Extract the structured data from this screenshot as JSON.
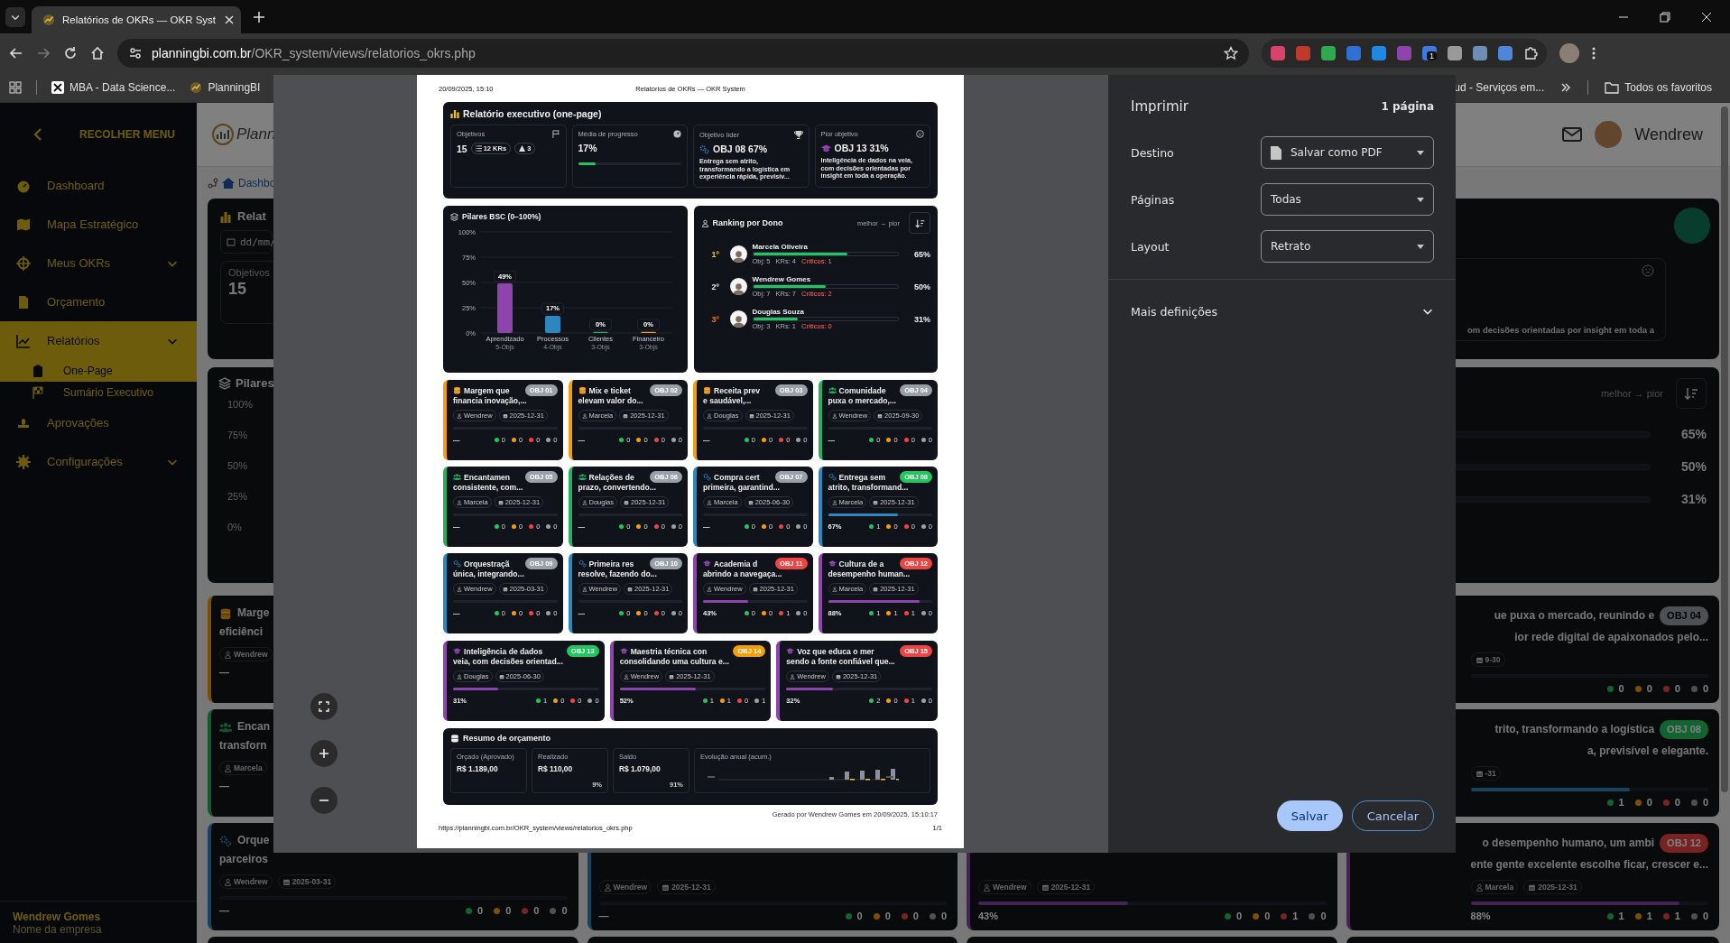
{
  "browser": {
    "tab_title": "Relatórios de OKRs — OKR Syst",
    "url_host": "planningbi.com.br",
    "url_path": "/OKR_system/views/relatorios_okrs.php",
    "extension_badge": "1",
    "bookmarks_left": [
      "MBA - Data Science...",
      "PlanningBI"
    ],
    "bookmarks_right": [
      "ud - Serviços em...",
      "Todos os favoritos"
    ]
  },
  "sidebar": {
    "collapse_label": "RECOLHER MENU",
    "items": [
      {
        "label": "Dashboard",
        "kind": "link",
        "selected": false
      },
      {
        "label": "Mapa Estratégico",
        "kind": "link",
        "selected": false
      },
      {
        "label": "Meus OKRs",
        "kind": "group",
        "selected": false
      },
      {
        "label": "Orçamento",
        "kind": "link",
        "selected": false
      },
      {
        "label": "Relatórios",
        "kind": "group",
        "selected": true,
        "children": [
          {
            "label": "One-Page",
            "selected": true
          },
          {
            "label": "Sumário Executivo",
            "selected": false
          }
        ]
      },
      {
        "label": "Aprovações",
        "kind": "link",
        "selected": false
      },
      {
        "label": "Configurações",
        "kind": "group",
        "selected": false
      }
    ],
    "user_name": "Wendrew Gomes",
    "company": "Nome da empresa"
  },
  "background": {
    "logo_text": "Plann",
    "breadcrumb": "Dashbo",
    "user": "Wendrew",
    "exec": {
      "title": "Relat",
      "date_placeholder": "dd/mm/",
      "kpi_label": "Objetivos",
      "kpi_value": "15",
      "worst_text": "om decisões orientadas por insight em toda a"
    },
    "pillars": {
      "title": "Pilares",
      "ticks": [
        "100%",
        "75%",
        "50%",
        "25%",
        "0%"
      ]
    },
    "ranking": {
      "hint": "melhor → pior",
      "values": [
        "65%",
        "50%",
        "31%"
      ]
    },
    "left_cards": [
      {
        "kind": "financeiro",
        "title_lines": [
          "Marge",
          "eficiênci"
        ],
        "owner": "Wendrew",
        "progress": "—"
      },
      {
        "kind": "clientes",
        "title_lines": [
          "Encan",
          "transforn"
        ],
        "owner": "Marcela",
        "progress": "—"
      },
      {
        "kind": "processos",
        "title_lines": [
          "Orque",
          "parceiros"
        ],
        "owner": "Wendrew",
        "date": "2025-03-31",
        "level": 0,
        "progress": "—",
        "counts": [
          "0",
          "0",
          "0",
          "0"
        ]
      }
    ],
    "bottom_cards": [
      {
        "kind": "processos",
        "owner": "Wendrew",
        "date": "2025-12-31",
        "level": 0,
        "progress": "—",
        "counts": [
          "0",
          "0",
          "0",
          "0"
        ]
      },
      {
        "kind": "aprendizado",
        "owner": "Wendrew",
        "date": "2025-12-31",
        "level": 0.43,
        "progress": "43%",
        "counts": [
          "0",
          "0",
          "1",
          "0"
        ]
      }
    ],
    "right_cards": [
      {
        "kind": "clientes",
        "title_lines": [
          "ue puxa o mercado, reunindo e",
          "ior rede digital de apaixonados pelo..."
        ],
        "badge": "OBJ 04",
        "color": "#4d5054",
        "date": "9-30",
        "level": 0,
        "counts": [
          "0",
          "0",
          "0",
          "0"
        ]
      },
      {
        "kind": "processos",
        "title_lines": [
          "trito, transformando a logística",
          "a, previsível e elegante."
        ],
        "badge": "OBJ 08",
        "color": "#11632f",
        "date": "-31",
        "level": 0.67,
        "counts": [
          "1",
          "0",
          "0",
          "0"
        ]
      },
      {
        "kind": "aprendizado",
        "title_lines": [
          "o desempenho humano, um ambi",
          "ente gente excelente escolhe ficar, crescer e..."
        ],
        "badge": "OBJ 12",
        "color": "#782222",
        "owner": "Marcela",
        "date": "2025-12-31",
        "level": 0.88,
        "progress": "88%",
        "counts": [
          "1",
          "1",
          "1",
          "0"
        ]
      }
    ]
  },
  "preview": {
    "print_date": "20/09/2025, 15:10",
    "print_title": "Relatórios de OKRs — OKR System",
    "exec": {
      "title": "Relatório executivo (one-page)",
      "kpis": [
        {
          "kind": "count",
          "label": "Objetivos",
          "value": "15",
          "chips": [
            "12 KRs",
            "3"
          ]
        },
        {
          "kind": "progress",
          "label": "Média de progresso",
          "value": "17%",
          "level": 0.17
        },
        {
          "kind": "best",
          "label": "Objetivo líder",
          "value": "OBJ 08 67%",
          "icon": {
            "kind": "processos"
          },
          "text": "Entrega sem atrito, transformando a logística em experiência rápida, previsív..."
        },
        {
          "kind": "worst",
          "label": "Pior objetivo",
          "value": "OBJ 13 31%",
          "icon": {
            "kind": "aprendizado"
          },
          "text": "Inteligência de dados na veia, com decisões orientadas por insight em toda a operação."
        }
      ]
    },
    "pillars": {
      "bars": [
        {
          "color": "#8e44ad",
          "objs": "5-Objs"
        },
        {
          "color": "#2e86c1",
          "objs": "4-Objs"
        },
        {
          "color": "#27ae60",
          "objs": "3-Objs"
        },
        {
          "color": "#f39c12",
          "objs": "3-Objs"
        }
      ],
      "chart_data": {
        "type": "bar",
        "title": "Pilares BSC (0–100%)",
        "categories": [
          "Aprendizado",
          "Processos",
          "Clientes",
          "Financeiro"
        ],
        "values": [
          49,
          17,
          0,
          0
        ],
        "ylim": [
          0,
          100
        ],
        "yticks": [
          {
            "value": 0,
            "label": "0%"
          },
          {
            "value": 25,
            "label": "25%"
          },
          {
            "value": 50,
            "label": "50%"
          },
          {
            "value": 75,
            "label": "75%"
          },
          {
            "value": 100,
            "label": "100%"
          }
        ],
        "grid": true,
        "data_labels": true,
        "value_labels": [
          "49%",
          "17%",
          "0%",
          "0%"
        ]
      }
    },
    "ranking": {
      "title": "Ranking por Dono",
      "hint": "melhor → pior",
      "owners": [
        {
          "rank": "1º",
          "color": "#f1c40f",
          "name": "Marcela Oliveira",
          "level": 0.65,
          "percent": "65%",
          "obj": "Obj: 5",
          "krs": "KRs: 4",
          "critical": "Críticos: 1"
        },
        {
          "rank": "2º",
          "color": "#e6e6e6",
          "name": "Wendrew Gomes",
          "level": 0.5,
          "percent": "50%",
          "obj": "Obj: 7",
          "krs": "KRs: 7",
          "critical": "Críticos: 2"
        },
        {
          "rank": "3º",
          "color": "#e67e22",
          "name": "Douglas Souza",
          "level": 0.31,
          "percent": "31%",
          "obj": "Obj: 3",
          "krs": "KRs: 1",
          "critical": "Críticos: 0"
        }
      ]
    },
    "objectives": [
      {
        "kind": "financeiro",
        "title_lines": [
          "Margem que",
          "financia inovação,..."
        ],
        "badge": "OBJ 01",
        "color": "#9aa0a8",
        "owner": "Wendrew",
        "date": "2025-12-31",
        "level": 0,
        "progress": "—",
        "counts": [
          "0",
          "0",
          "0",
          "0"
        ]
      },
      {
        "kind": "financeiro",
        "title_lines": [
          "Mix e ticket",
          "elevam valor do..."
        ],
        "badge": "OBJ 02",
        "color": "#9aa0a8",
        "owner": "Marcela",
        "date": "2025-12-31",
        "level": 0,
        "progress": "—",
        "counts": [
          "0",
          "0",
          "0",
          "0"
        ]
      },
      {
        "kind": "financeiro",
        "title_lines": [
          "Receita prev",
          "e saudável,..."
        ],
        "badge": "OBJ 03",
        "color": "#9aa0a8",
        "owner": "Douglas",
        "date": "2025-12-31",
        "level": 0,
        "progress": "—",
        "counts": [
          "0",
          "0",
          "0",
          "0"
        ]
      },
      {
        "kind": "clientes",
        "title_lines": [
          "Comunidade",
          "puxa o mercado,..."
        ],
        "badge": "OBJ 04",
        "color": "#9aa0a8",
        "owner": "Wendrew",
        "date": "2025-09-30",
        "level": 0,
        "progress": "—",
        "counts": [
          "0",
          "0",
          "0",
          "0"
        ]
      },
      {
        "kind": "clientes",
        "title_lines": [
          "Encantamen",
          "consistente, com..."
        ],
        "badge": "OBJ 05",
        "color": "#9aa0a8",
        "owner": "Marcela",
        "date": "2025-12-31",
        "level": 0,
        "progress": "—",
        "counts": [
          "0",
          "0",
          "0",
          "0"
        ]
      },
      {
        "kind": "clientes",
        "title_lines": [
          "Relações de",
          "prazo, convertendo..."
        ],
        "badge": "OBJ 06",
        "color": "#9aa0a8",
        "owner": "Douglas",
        "date": "2025-12-31",
        "level": 0,
        "progress": "—",
        "counts": [
          "0",
          "0",
          "0",
          "0"
        ]
      },
      {
        "kind": "processos",
        "title_lines": [
          "Compra cert",
          "primeira, garantind..."
        ],
        "badge": "OBJ 07",
        "color": "#9aa0a8",
        "owner": "Marcela",
        "date": "2025-06-30",
        "level": 0,
        "progress": "—",
        "counts": [
          "0",
          "0",
          "0",
          "0"
        ]
      },
      {
        "kind": "processos",
        "title_lines": [
          "Entrega sem",
          "atrito, transformand..."
        ],
        "badge": "OBJ 08",
        "color": "#22c55e",
        "owner": "Marcela",
        "date": "2025-12-31",
        "level": 0.67,
        "progress": "67%",
        "counts": [
          "1",
          "0",
          "0",
          "0"
        ]
      },
      {
        "kind": "processos",
        "title_lines": [
          "Orquestraçã",
          "única, integrando..."
        ],
        "badge": "OBJ 09",
        "color": "#9aa0a8",
        "owner": "Wendrew",
        "date": "2025-03-31",
        "level": 0,
        "progress": "—",
        "counts": [
          "0",
          "0",
          "0",
          "0"
        ]
      },
      {
        "kind": "processos",
        "title_lines": [
          "Primeira res",
          "resolve, fazendo do..."
        ],
        "badge": "OBJ 10",
        "color": "#9aa0a8",
        "owner": "Wendrew",
        "date": "2025-12-31",
        "level": 0,
        "progress": "—",
        "counts": [
          "0",
          "0",
          "0",
          "0"
        ]
      },
      {
        "kind": "aprendizado",
        "title_lines": [
          "Academia d",
          "abrindo a navegaça..."
        ],
        "badge": "OBJ 11",
        "color": "#ef4444",
        "owner": "Wendrew",
        "date": "2025-12-31",
        "level": 0.43,
        "progress": "43%",
        "counts": [
          "0",
          "0",
          "1",
          "0"
        ]
      },
      {
        "kind": "aprendizado",
        "title_lines": [
          "Cultura de a",
          "desempenho human..."
        ],
        "badge": "OBJ 12",
        "color": "#ef4444",
        "owner": "Marcela",
        "date": "2025-12-31",
        "level": 0.88,
        "progress": "88%",
        "counts": [
          "1",
          "1",
          "1",
          "0"
        ]
      },
      {
        "kind": "aprendizado",
        "title_lines": [
          "Inteligência de dados",
          "veia, com decisões orientad..."
        ],
        "badge": "OBJ 13",
        "color": "#22c55e",
        "owner": "Douglas",
        "date": "2025-06-30",
        "level": 0.31,
        "progress": "31%",
        "counts": [
          "1",
          "0",
          "0",
          "0"
        ]
      },
      {
        "kind": "aprendizado",
        "title_lines": [
          "Maestria técnica con",
          "consolidando uma cultura e..."
        ],
        "badge": "OBJ 14",
        "color": "#f59e0b",
        "owner": "Wendrew",
        "date": "2025-12-31",
        "level": 0.52,
        "progress": "52%",
        "counts": [
          "1",
          "1",
          "0",
          "1"
        ]
      },
      {
        "kind": "aprendizado",
        "title_lines": [
          "Voz que educa o mer",
          "sendo a fonte confiável que..."
        ],
        "badge": "OBJ 15",
        "color": "#ef4444",
        "owner": "Wendrew",
        "date": "2025-12-31",
        "level": 0.32,
        "progress": "32%",
        "counts": [
          "2",
          "0",
          "1",
          "0"
        ]
      }
    ],
    "budget": {
      "title": "Resumo de orçamento",
      "tiles": [
        {
          "label": "Orçado (Aprovado)",
          "value": "R$ 1.189,00"
        },
        {
          "label": "Realizado",
          "value": "R$ 110,00",
          "share": "9%"
        },
        {
          "label": "Saldo",
          "value": "R$ 1.079,00",
          "share": "91%"
        }
      ],
      "evolution_label": "Evolução anual (acum.)"
    },
    "generated": "Gerado por Wendrew Gomes em 20/09/2025, 15:10:17",
    "footer_url": "https://planningbi.com.br/OKR_system/views/relatorios_okrs.php",
    "footer_page": "1/1"
  },
  "print_dialog": {
    "title": "Imprimir",
    "page_count": "1 página",
    "fields": [
      {
        "kind": "destination",
        "label": "Destino",
        "value": "Salvar como PDF"
      },
      {
        "kind": "plain",
        "label": "Páginas",
        "value": "Todas"
      },
      {
        "kind": "plain",
        "label": "Layout",
        "value": "Retrato"
      }
    ],
    "more": "Mais definições",
    "buttons": [
      {
        "kind": "primary",
        "label": "Salvar"
      },
      {
        "kind": "secondary",
        "label": "Cancelar"
      }
    ]
  }
}
